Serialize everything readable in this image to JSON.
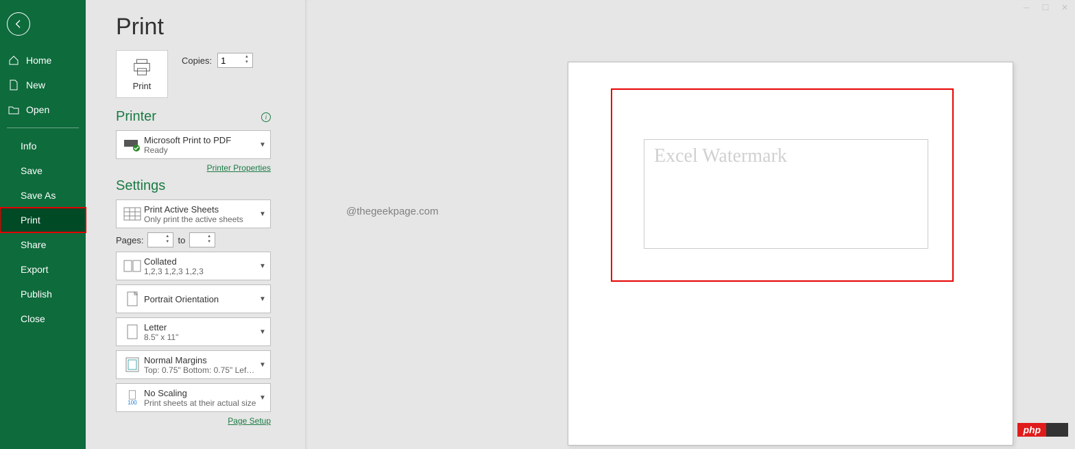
{
  "sidebar": {
    "items": [
      {
        "label": "Home",
        "icon": "home"
      },
      {
        "label": "New",
        "icon": "new"
      },
      {
        "label": "Open",
        "icon": "open"
      }
    ],
    "items2": [
      {
        "label": "Info"
      },
      {
        "label": "Save"
      },
      {
        "label": "Save As"
      },
      {
        "label": "Print"
      },
      {
        "label": "Share"
      },
      {
        "label": "Export"
      },
      {
        "label": "Publish"
      },
      {
        "label": "Close"
      }
    ]
  },
  "page_title": "Print",
  "print_button": "Print",
  "copies": {
    "label": "Copies:",
    "value": "1"
  },
  "printer": {
    "heading": "Printer",
    "name": "Microsoft Print to PDF",
    "status": "Ready",
    "props_link": "Printer Properties"
  },
  "settings": {
    "heading": "Settings",
    "sheets": {
      "title": "Print Active Sheets",
      "sub": "Only print the active sheets"
    },
    "pages_label": "Pages:",
    "pages_to": "to",
    "collated": {
      "title": "Collated",
      "sub": "1,2,3    1,2,3    1,2,3"
    },
    "orientation": {
      "title": "Portrait Orientation"
    },
    "paper": {
      "title": "Letter",
      "sub": "8.5\" x 11\""
    },
    "margins": {
      "title": "Normal Margins",
      "sub": "Top: 0.75\" Bottom: 0.75\" Lef…"
    },
    "scaling": {
      "title": "No Scaling",
      "sub": "Print sheets at their actual size",
      "badge": "100"
    },
    "page_setup": "Page Setup"
  },
  "overlay": "@thegeekpage.com",
  "watermark": "Excel Watermark",
  "php_badge": "php"
}
